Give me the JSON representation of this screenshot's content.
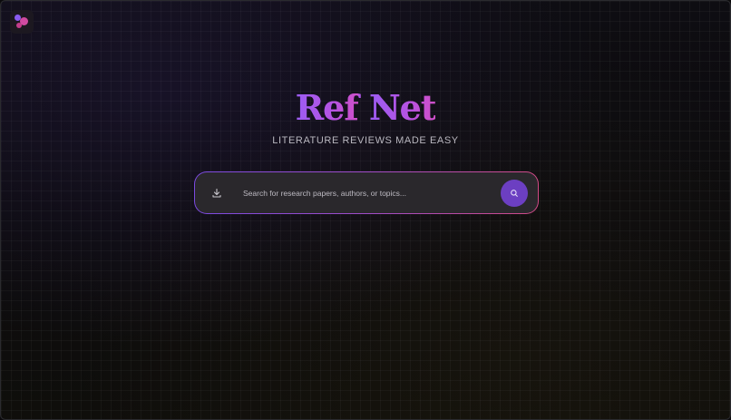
{
  "app": {
    "title_prefix": "Ref",
    "title_suffix": "Net",
    "tagline": "LITERATURE REVIEWS MADE EASY"
  },
  "search": {
    "placeholder": "Search for research papers, authors, or topics...",
    "value": ""
  },
  "icons": {
    "logo": "three-dots-logo-icon",
    "download": "download-icon",
    "search": "search-icon"
  },
  "colors": {
    "title_gradient_start": "#9b5cf2",
    "title_gradient_end": "#cf4fc8",
    "search_button": "#6c3fc2",
    "search_border_start": "#7b4ae0",
    "search_border_end": "#d14a86",
    "background": "#0c0b0d"
  }
}
